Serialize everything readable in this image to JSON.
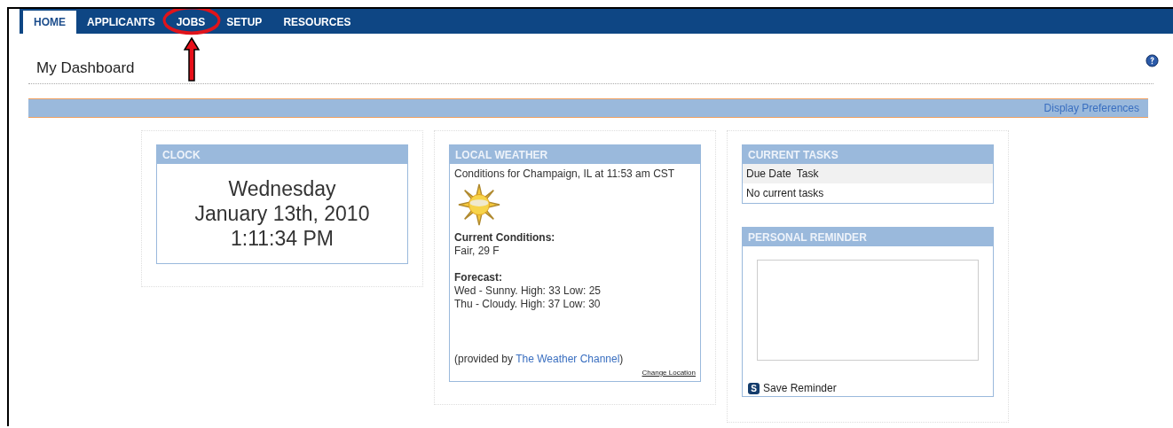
{
  "tabs": [
    {
      "label": "HOME",
      "selected": true,
      "circled": false
    },
    {
      "label": "APPLICANTS",
      "selected": false,
      "circled": false
    },
    {
      "label": "JOBS",
      "selected": false,
      "circled": true
    },
    {
      "label": "SETUP",
      "selected": false,
      "circled": false
    },
    {
      "label": "RESOURCES",
      "selected": false,
      "circled": false
    }
  ],
  "page_title": "My Dashboard",
  "display_preferences": "Display Preferences",
  "clock": {
    "title": "CLOCK",
    "day": "Wednesday",
    "date": "January 13th, 2010",
    "time": "1:11:34 PM"
  },
  "weather": {
    "title": "LOCAL WEATHER",
    "conditions_for": "Conditions for Champaign, IL at 11:53 am CST",
    "current_label": "Current Conditions:",
    "current": "Fair, 29 F",
    "forecast_label": "Forecast:",
    "forecast": [
      "Wed - Sunny. High: 33 Low: 25",
      "Thu - Cloudy. High: 37 Low: 30"
    ],
    "provided_prefix": "(provided by ",
    "provider_link": "The Weather Channel",
    "provided_suffix": ")",
    "change_location": "Change Location"
  },
  "tasks": {
    "title": "CURRENT TASKS",
    "columns": [
      "Due Date",
      "Task"
    ],
    "empty": "No current tasks"
  },
  "reminder": {
    "title": "PERSONAL REMINDER",
    "save_icon_letter": "S",
    "save_label": "Save Reminder"
  }
}
